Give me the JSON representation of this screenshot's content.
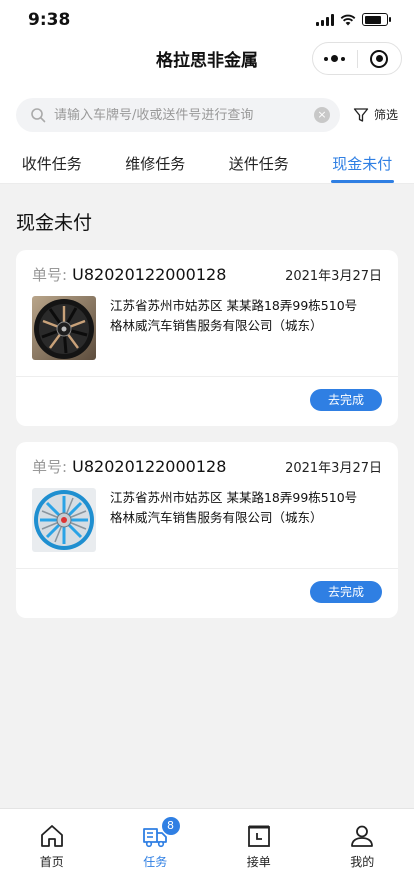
{
  "status": {
    "time": "9:38"
  },
  "nav": {
    "title": "格拉思非金属"
  },
  "search": {
    "placeholder": "请输入车牌号/收或送件号进行查询",
    "clear": "×"
  },
  "filter": {
    "label": "筛选"
  },
  "tabs": [
    {
      "label": "收件任务",
      "active": false
    },
    {
      "label": "维修任务",
      "active": false
    },
    {
      "label": "送件任务",
      "active": false
    },
    {
      "label": "现金未付",
      "active": true
    }
  ],
  "section": {
    "title": "现金未付"
  },
  "orders": [
    {
      "label": "单号:",
      "number": "U82020122000128",
      "date": "2021年3月27日",
      "address": "江苏省苏州市姑苏区 某某路18弄99栋510号 格林威汽车销售服务有限公司（城东）",
      "image": "black-bronze-alloy-wheel",
      "action": "去完成"
    },
    {
      "label": "单号:",
      "number": "U82020122000128",
      "date": "2021年3月27日",
      "address": "江苏省苏州市姑苏区 某某路18弄99栋510号 格林威汽车销售服务有限公司（城东）",
      "image": "blue-silver-alloy-wheel",
      "action": "去完成"
    }
  ],
  "tabbar": {
    "items": [
      {
        "label": "首页",
        "icon": "home-icon",
        "active": false
      },
      {
        "label": "任务",
        "icon": "truck-icon",
        "active": true,
        "badge": "8"
      },
      {
        "label": "接单",
        "icon": "calendar-icon",
        "active": false
      },
      {
        "label": "我的",
        "icon": "user-icon",
        "active": false
      }
    ]
  },
  "colors": {
    "accent": "#2f7fe3",
    "background": "#f2f2f2"
  }
}
